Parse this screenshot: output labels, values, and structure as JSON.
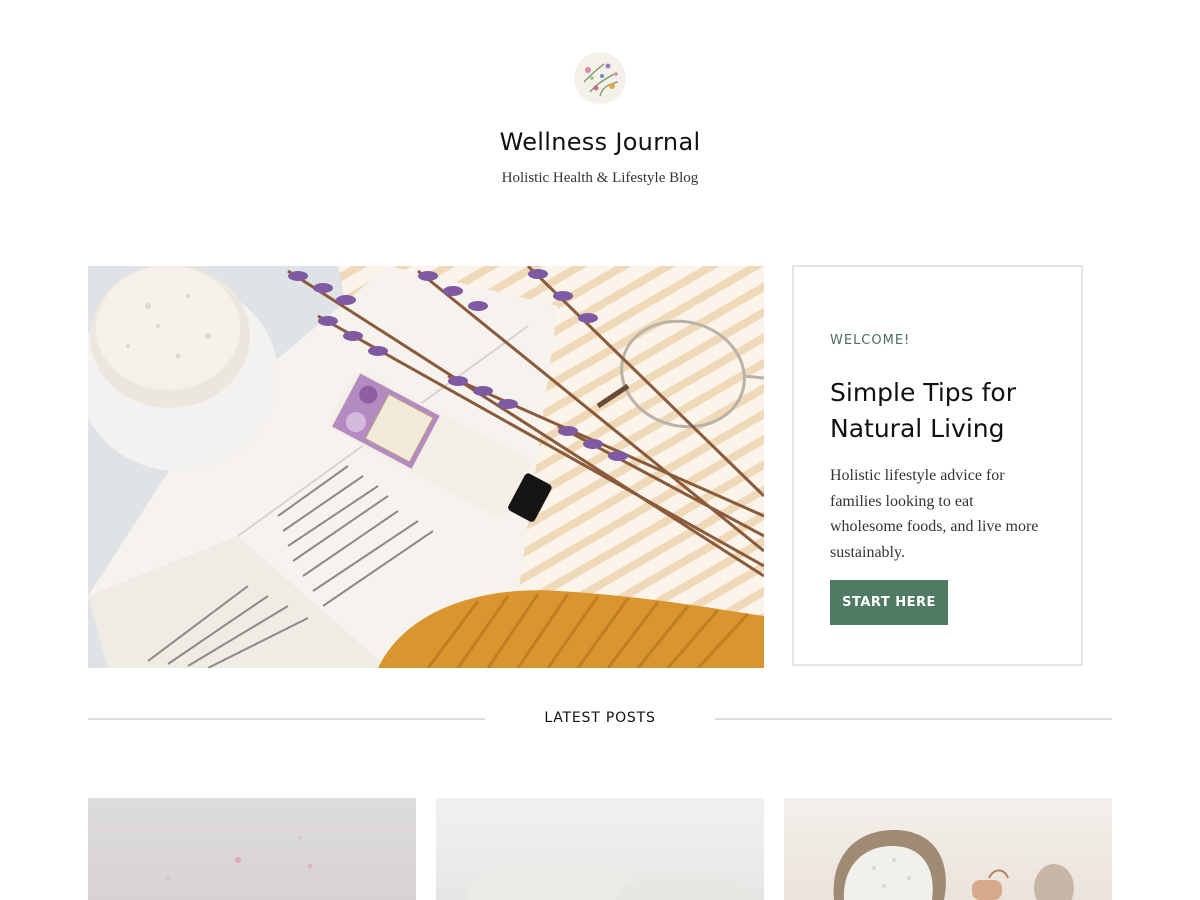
{
  "site": {
    "title": "Wellness Journal",
    "tagline": "Holistic Health & Lifestyle Blog"
  },
  "hero": {
    "image_icon": "flatlay-photo-lavender-book-glasses"
  },
  "welcome_card": {
    "kicker": "WELCOME!",
    "title": "Simple Tips for Natural Living",
    "text": "Holistic lifestyle advice for families looking to eat wholesome foods, and live more sustainably.",
    "button_label": "START HERE"
  },
  "latest": {
    "heading": "LATEST POSTS"
  },
  "colors": {
    "accent": "#517a64",
    "kicker": "#4e6e5d",
    "card_border": "#dfe6e3"
  }
}
